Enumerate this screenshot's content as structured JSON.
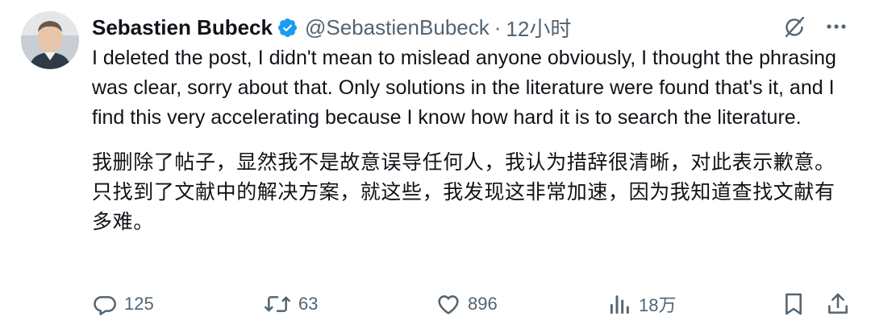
{
  "author": {
    "name": "Sebastien Bubeck",
    "handle": "@SebastienBubeck",
    "separator": "·",
    "time": "12小时",
    "verified": true,
    "verified_color": "#1d9bf0"
  },
  "post": {
    "text_en": "I deleted the post, I didn't mean to mislead anyone obviously, I thought the phrasing was clear, sorry about that. Only solutions in the literature were found that's it, and I find this very accelerating because I know how hard it is to search the literature.",
    "text_zh": "我删除了帖子，显然我不是故意误导任何人，我认为措辞很清晰，对此表示歉意。只找到了文献中的解决方案，就这些，我发现这非常加速，因为我知道查找文献有多难。"
  },
  "top_icons": [
    "grok-icon",
    "more-icon"
  ],
  "actions": {
    "reply_count": "125",
    "retweet_count": "63",
    "like_count": "896",
    "views_count": "18万"
  },
  "colors": {
    "text": "#0f1419",
    "secondary": "#536471"
  }
}
